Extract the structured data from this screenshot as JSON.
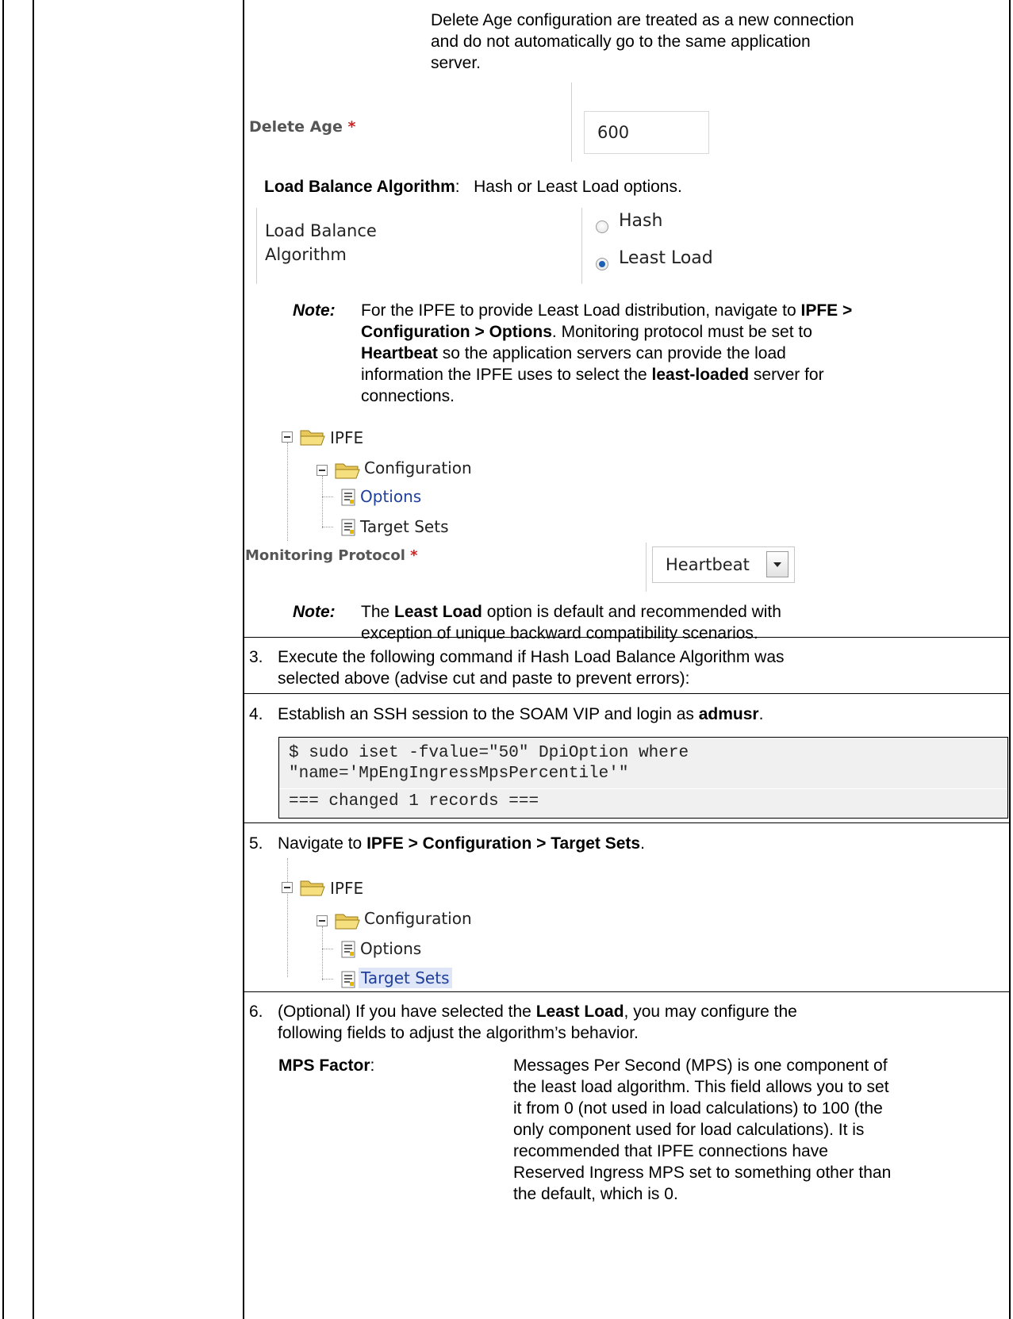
{
  "intro": {
    "lines": [
      "Delete Age configuration are treated as a new connection",
      "and do not automatically go to the same application",
      "server."
    ]
  },
  "delete_age": {
    "label": "Delete Age",
    "required_mark": "*",
    "value": "600"
  },
  "load_balance_desc": {
    "term": "Load Balance Algorithm",
    "colon": ":",
    "text": "Hash or Least Load options."
  },
  "load_balance_ui": {
    "label_line1": "Load Balance",
    "label_line2": "Algorithm",
    "options": [
      {
        "label": "Hash",
        "selected": false
      },
      {
        "label": "Least Load",
        "selected": true
      }
    ]
  },
  "note1": {
    "label": "Note:",
    "line1": {
      "a": "For the IPFE to provide Least Load distribution, navigate to ",
      "b": "IPFE >"
    },
    "line2": {
      "a": "Configuration > Options",
      "b": ".  Monitoring protocol must be set to"
    },
    "line3": {
      "a": "Heartbeat",
      "b": " so the application servers can provide the load"
    },
    "line4": {
      "a": "information the IPFE uses to select the ",
      "b": "least-loaded",
      "c": " server for"
    },
    "line5": "connections."
  },
  "tree1": {
    "root": "IPFE",
    "child": "Configuration",
    "items": [
      "Options",
      "Target Sets"
    ],
    "selected": "Options"
  },
  "monitoring": {
    "label": "Monitoring Protocol",
    "required_mark": "*",
    "value": "Heartbeat"
  },
  "note2": {
    "label": "Note:",
    "line1": {
      "a": "The ",
      "b": "Least Load",
      "c": " option is default and recommended with"
    },
    "line2": "exception of unique backward compatibility scenarios."
  },
  "step3": {
    "num": "3.",
    "line1": "Execute the following command if Hash Load Balance Algorithm was",
    "line2": "selected above (advise cut and paste to prevent errors):"
  },
  "step4": {
    "num": "4.",
    "a": "Establish an SSH session to the SOAM VIP and login as ",
    "b": "admusr",
    "c": "."
  },
  "code": {
    "line1": "$ sudo iset -fvalue=\"50\" DpiOption where",
    "line2": "\"name='MpEngIngressMpsPercentile'\"",
    "line3": "=== changed 1 records ==="
  },
  "step5": {
    "num": "5.",
    "a": "Navigate to ",
    "b": "IPFE > Configuration > Target Sets",
    "c": "."
  },
  "tree2": {
    "root": "IPFE",
    "child": "Configuration",
    "items": [
      "Options",
      "Target Sets"
    ],
    "selected": "Target Sets"
  },
  "step6": {
    "num": "6.",
    "line1": {
      "a": "(Optional) If you have selected the ",
      "b": "Least Load",
      "c": ", you may configure the"
    },
    "line2": "following fields to adjust the algorithm’s behavior."
  },
  "mps": {
    "term": "MPS Factor",
    "colon": ":",
    "lines": [
      "Messages Per Second (MPS) is one component of",
      "the least load algorithm.  This field allows you to set",
      "it from 0 (not used in load calculations) to 100 (the",
      "only component used for load calculations).  It is",
      "recommended that IPFE connections have",
      "Reserved Ingress MPS set to something other than",
      "the default, which is 0."
    ]
  }
}
